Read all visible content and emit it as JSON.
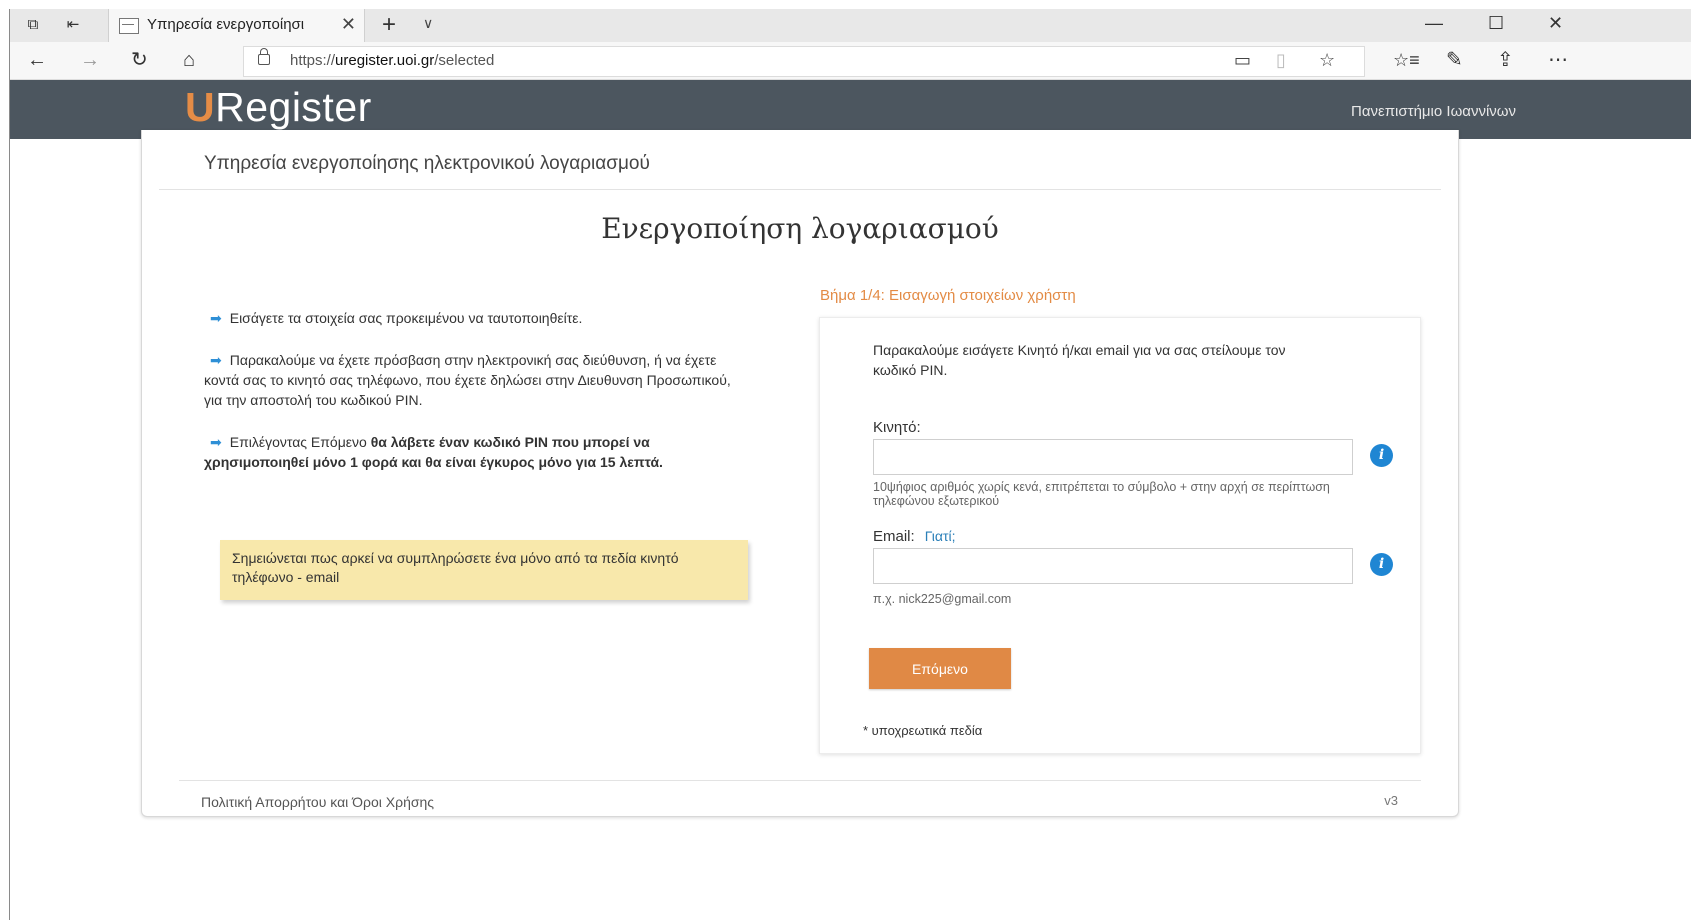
{
  "browser": {
    "tab_title": "Υπηρεσία ενεργοποίησι",
    "url_prefix": "https://",
    "url_host": "uregister.uoi.gr",
    "url_path": "/selected",
    "icons": [
      "tab-set-aside-icon",
      "tab-restore-icon",
      "favicon-icon",
      "close-tab-icon",
      "new-tab-icon",
      "tab-list-icon",
      "minimize-icon",
      "maximize-icon",
      "close-window-icon",
      "back-icon",
      "forward-icon",
      "refresh-icon",
      "home-icon",
      "lock-icon",
      "reading-view-icon",
      "book-icon",
      "favorite-star-icon",
      "favorites-list-icon",
      "pen-icon",
      "share-icon",
      "more-icon"
    ]
  },
  "header": {
    "logo_u": "U",
    "logo_rest": "Register",
    "university": "Πανεπιστήμιο Ιωαννίνων"
  },
  "page": {
    "subtitle": "Υπηρεσία ενεργοποίησης ηλεκτρονικού λογαριασμού",
    "title": "Ενεργοποίηση λογαριασμού"
  },
  "instructions": {
    "p1": "Εισάγετε τα στοιχεία σας προκειμένου να ταυτοποιηθείτε.",
    "p2": "Παρακαλούμε να έχετε πρόσβαση στην ηλεκτρονική σας διεύθυνση, ή να έχετε κοντά σας το κινητό σας τηλέφωνο, που έχετε δηλώσει στην Διευθυνση Προσωπικού, για την αποστολή του κωδικού PIN.",
    "p3_normal": "Επιλέγοντας Επόμενο ",
    "p3_bold": "θα λάβετε έναν κωδικό PIN που μπορεί να χρησιμοποιηθεί μόνο 1 φορά και θα είναι έγκυρος μόνο για 15 λεπτά.",
    "note": "Σημειώνεται πως αρκεί να συμπληρώσετε ένα μόνο από τα πεδία κινητό τηλέφωνο - email"
  },
  "form": {
    "step_title": "Βήμα 1/4: Εισαγωγή στοιχείων χρήστη",
    "intro": "Παρακαλούμε εισάγετε Κινητό ή/και email για να σας στείλουμε τον κωδικό PIN.",
    "mobile_label": "Κινητό:",
    "mobile_value": "",
    "mobile_hint": "10ψήφιος αριθμός χωρίς κενά, επιτρέπεται το σύμβολο + στην αρχή σε περίπτωση τηλεφώνου εξωτερικού",
    "email_label": "Email:",
    "email_why": "Γιατί;",
    "email_value": "",
    "email_hint": "π.χ. nick225@gmail.com",
    "info_symbol": "i",
    "next_button": "Επόμενο",
    "required_note": "* υποχρεωτικά πεδία"
  },
  "footer": {
    "privacy": "Πολιτική Απορρήτου και Όροι Χρήσης",
    "version": "v3"
  },
  "colors": {
    "header_bg": "#4c565f",
    "accent_orange": "#e08945",
    "info_blue": "#1f86d3",
    "note_bg": "#f8e8ab"
  }
}
